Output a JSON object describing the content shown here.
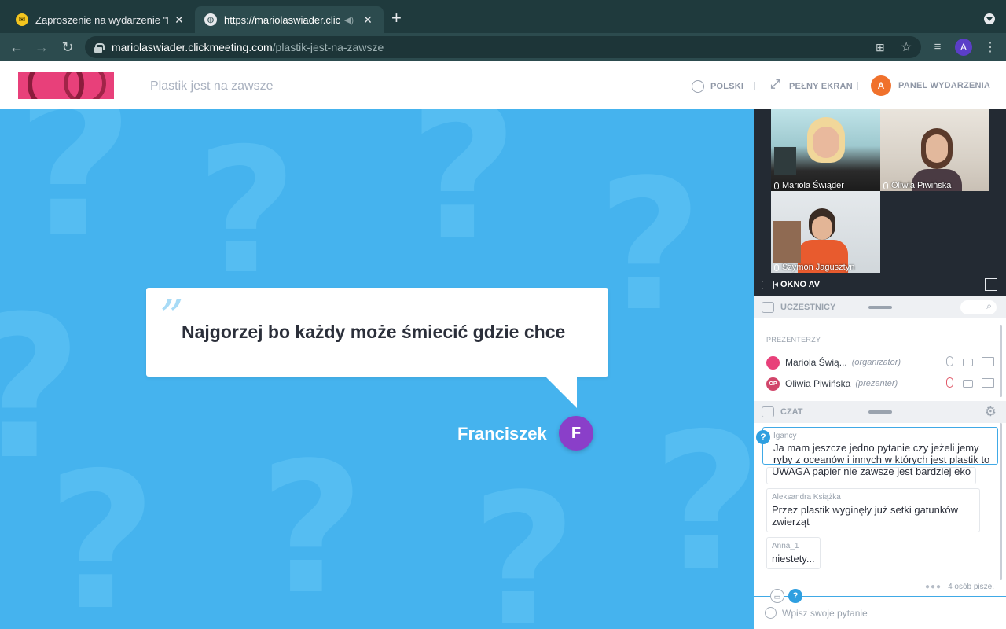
{
  "browser": {
    "tabs": [
      {
        "title": "Zaproszenie na wydarzenie \"Pl",
        "icon": "mail-icon"
      },
      {
        "title": "https://mariolaswiader.click",
        "icon": "globe-icon"
      }
    ],
    "new_tab": "+",
    "url_host": "mariolaswiader.clickmeeting.com",
    "url_path": "/plastik-jest-na-zawsze",
    "profile_initial": "A"
  },
  "header": {
    "event_title": "Plastik jest na zawsze",
    "language": "POLSKI",
    "fullscreen": "PEŁNY EKRAN",
    "panel_avatar": "A",
    "panel": "PANEL WYDARZENIA"
  },
  "stage": {
    "quote": "Najgorzej bo każdy może śmiecić gdzie chce",
    "quote_mark": "”",
    "author": "Franciszek",
    "author_initial": "F",
    "background": "#45b3ee"
  },
  "av": {
    "videos": [
      {
        "name": "Mariola Świąder"
      },
      {
        "name": "Oliwia Piwińska"
      },
      {
        "name": "Szymon Jagusztyn"
      }
    ],
    "label": "OKNO AV"
  },
  "participants": {
    "title": "UCZESTNICY",
    "group_label": "PREZENTERZY",
    "list": [
      {
        "name": "Mariola Świą...",
        "role": "(organizator)",
        "initials": ""
      },
      {
        "name": "Oliwia Piwińska",
        "role": "(prezenter)",
        "initials": "OP"
      }
    ]
  },
  "chat": {
    "title": "CZAT",
    "question_badge": "?",
    "question": {
      "author": "Igancy",
      "text": "Ja mam jeszcze jedno pytanie czy jeżeli jemy ryby z oceanów i innych w których jest plastik to"
    },
    "messages": [
      {
        "author": "",
        "text": "UWAGA papier nie zawsze jest bardziej eko"
      },
      {
        "author": "Aleksandra Książka",
        "text": "Przez plastik wyginęły już setki gatunków zwierząt"
      },
      {
        "author": "Anna_1",
        "text": "niestety..."
      }
    ],
    "typing": "4 osób pisze.",
    "input_placeholder": "Wpisz swoje pytanie",
    "mode_question": "?"
  },
  "colors": {
    "accent": "#2f9fe0",
    "author_avatar": "#8a3fc9",
    "panel_avatar": "#f0712c"
  }
}
